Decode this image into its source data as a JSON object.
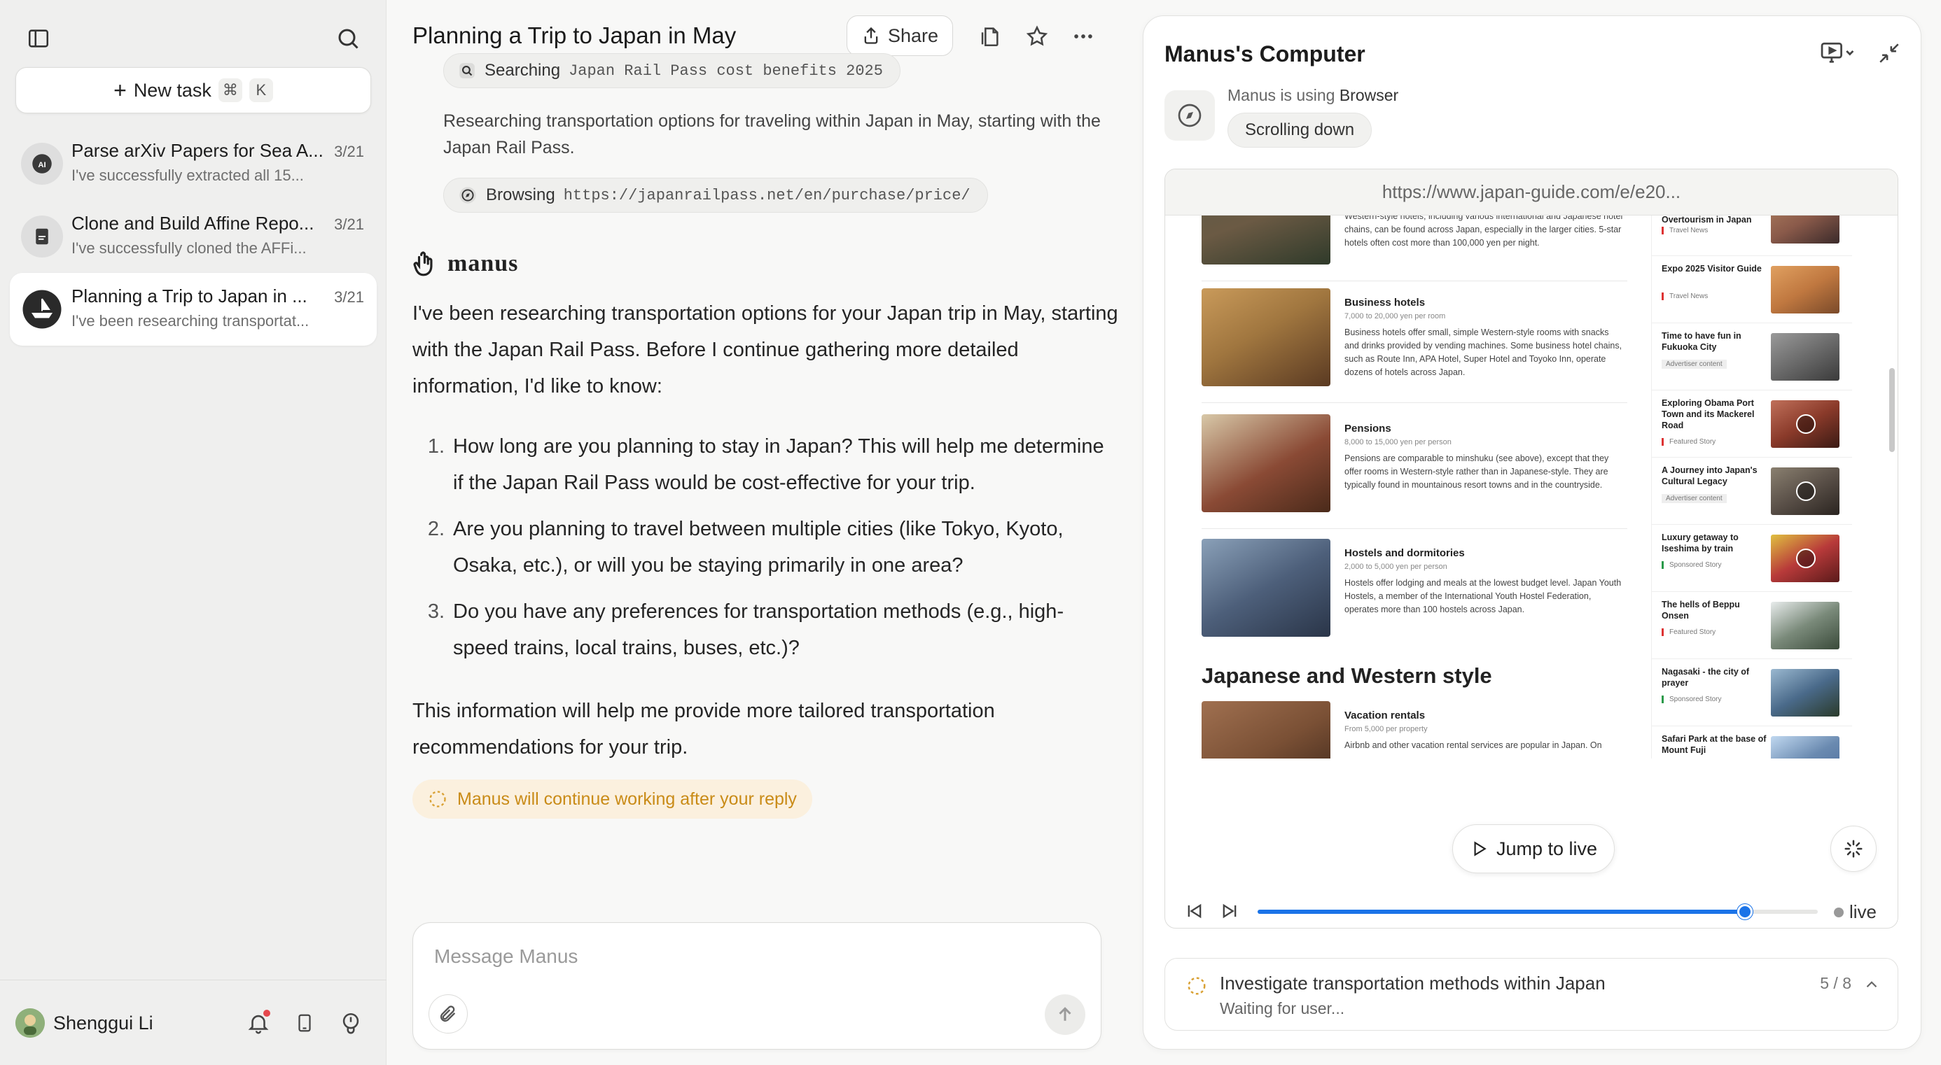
{
  "sidebar": {
    "new_task_label": "New task",
    "shortcut_cmd": "⌘",
    "shortcut_key": "K",
    "tasks": [
      {
        "title": "Parse arXiv Papers for Sea A...",
        "date": "3/21",
        "preview": "I've successfully extracted all 15...",
        "icon": "ai-icon"
      },
      {
        "title": "Clone and Build Affine Repo...",
        "date": "3/21",
        "preview": "I've successfully cloned the AFFi...",
        "icon": "document-icon"
      },
      {
        "title": "Planning a Trip to Japan in ...",
        "date": "3/21",
        "preview": "I've been researching transportat...",
        "icon": "boat-icon"
      }
    ],
    "user_name": "Shenggui Li"
  },
  "chat": {
    "title": "Planning a Trip to Japan in May",
    "share_label": "Share",
    "steps": [
      {
        "verb": "Searching",
        "arg": "Japan Rail Pass cost benefits 2025"
      },
      {
        "verb": "Browsing",
        "arg": "https://japanrailpass.net/en/purchase/price/"
      }
    ],
    "step_note": "Researching transportation options for traveling within Japan in May, starting with the Japan Rail Pass.",
    "agent_name": "manus",
    "intro": "I've been researching transportation options for your Japan trip in May, starting with the Japan Rail Pass. Before I continue gathering more detailed information, I'd like to know:",
    "questions": [
      {
        "num": "1.",
        "text": "How long are you planning to stay in Japan? This will help me determine if the Japan Rail Pass would be cost-effective for your trip."
      },
      {
        "num": "2.",
        "text": "Are you planning to travel between multiple cities (like Tokyo, Kyoto, Osaka, etc.), or will you be staying primarily in one area?"
      },
      {
        "num": "3.",
        "text": "Do you have any preferences for transportation methods (e.g., high-speed trains, local trains, buses, etc.)?"
      }
    ],
    "outro": "This information will help me provide more tailored transportation recommendations for your trip.",
    "working_note": "Manus will continue working after your reply",
    "composer_placeholder": "Message Manus"
  },
  "computer": {
    "title": "Manus's Computer",
    "using_prefix": "Manus is using",
    "using_tool": "Browser",
    "action": "Scrolling down",
    "url": "https://www.japan-guide.com/e/e20...",
    "page": {
      "hotels": [
        {
          "name": "",
          "price": "",
          "desc": "Western-style hotels, including various international and Japanese hotel chains, can be found across Japan, especially in the larger cities. 5-star hotels often cost more than 100,000 yen per night.",
          "img_color": "#6b5a44"
        },
        {
          "name": "Business hotels",
          "price": "7,000 to 20,000 yen per room",
          "desc": "Business hotels offer small, simple Western-style rooms with snacks and drinks provided by vending machines. Some business hotel chains, such as Route Inn, APA Hotel, Super Hotel and Toyoko Inn, operate dozens of hotels across Japan.",
          "img_color": "#a0763f"
        },
        {
          "name": "Pensions",
          "price": "8,000 to 15,000 yen per person",
          "desc": "Pensions are comparable to minshuku (see above), except that they offer rooms in Western-style rather than in Japanese-style. They are typically found in mountainous resort towns and in the countryside.",
          "img_color": "#8a4a35"
        },
        {
          "name": "Hostels and dormitories",
          "price": "2,000 to 5,000 yen per person",
          "desc": "Hostels offer lodging and meals at the lowest budget level. Japan Youth Hostels, a member of the International Youth Hostel Federation, operates more than 100 hostels across Japan.",
          "img_color": "#4d5f7a"
        }
      ],
      "section_heading": "Japanese and Western style",
      "last_item": {
        "name": "Vacation rentals",
        "price": "From 5,000 per property",
        "desc": "Airbnb and other vacation rental services are popular in Japan. On",
        "img_color": "#7a5035"
      },
      "stories": [
        {
          "title": "Overtourism in Japan",
          "tag": "Travel News",
          "tag_style": "red",
          "img_color": "#8a5a4a"
        },
        {
          "title": "Expo 2025 Visitor Guide",
          "tag": "Travel News",
          "tag_style": "red",
          "img_color": "#c07840"
        },
        {
          "title": "Time to have fun in Fukuoka City",
          "tag": "Advertiser content",
          "tag_style": "gray",
          "img_color": "#6a6a6a"
        },
        {
          "title": "Exploring Obama Port Town and its Mackerel Road",
          "tag": "Featured Story",
          "tag_style": "red",
          "img_color": "#8a3a2a"
        },
        {
          "title": "A Journey into Japan's Cultural Legacy",
          "tag": "Advertiser content",
          "tag_style": "gray",
          "img_color": "#5a5048"
        },
        {
          "title": "Luxury getaway to Iseshima by train",
          "tag": "Sponsored Story",
          "tag_style": "green",
          "img_color": "#b83a3a"
        },
        {
          "title": "The hells of Beppu Onsen",
          "tag": "Featured Story",
          "tag_style": "red",
          "img_color": "#7a8a7a"
        },
        {
          "title": "Nagasaki - the city of prayer",
          "tag": "Sponsored Story",
          "tag_style": "green",
          "img_color": "#4a6a8a"
        },
        {
          "title": "Safari Park at the base of Mount Fuji",
          "tag": "",
          "tag_style": "red",
          "img_color": "#6a8ab0"
        }
      ]
    },
    "jump_label": "Jump to live",
    "progress": 0.87,
    "live_label": "live",
    "status_title": "Investigate transportation methods within Japan",
    "status_sub": "Waiting for user...",
    "status_count": "5 / 8"
  },
  "colors": {
    "accent": "#1a73e8",
    "warning": "#c98b17",
    "warning_bg": "#fbf0de"
  }
}
